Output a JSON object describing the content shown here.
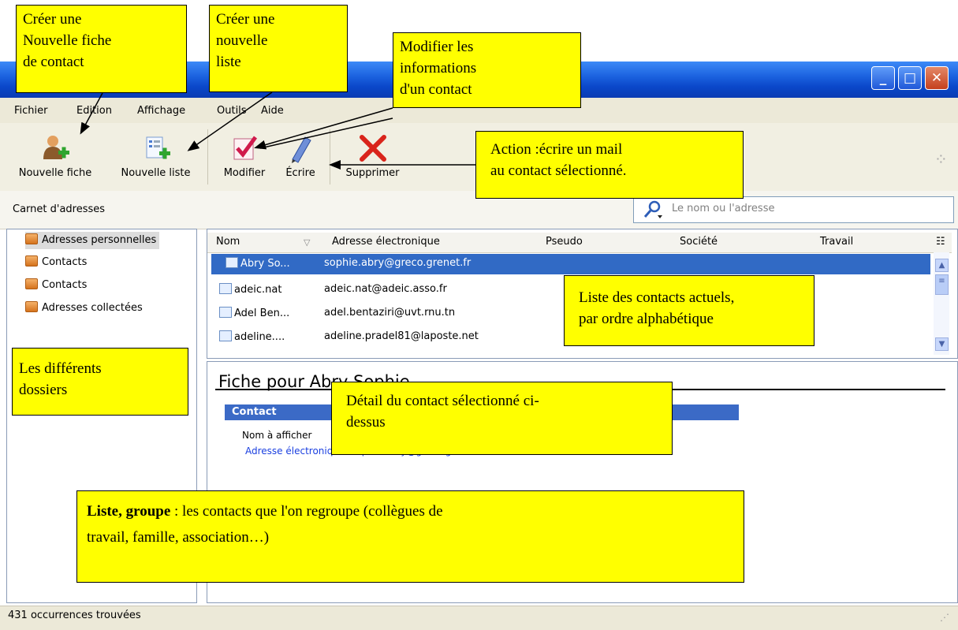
{
  "window": {
    "controls": [
      "_",
      "□",
      "✕"
    ]
  },
  "menu": [
    {
      "label": "Fichier",
      "key": "F"
    },
    {
      "label": "Edition",
      "key": "E"
    },
    {
      "label": "Affichage",
      "key": "c"
    },
    {
      "label": "Outils",
      "key": "O"
    },
    {
      "label": "Aide",
      "key": "A"
    }
  ],
  "toolbar": {
    "new_card": "Nouvelle fiche",
    "new_list": "Nouvelle liste",
    "edit": "Modifier",
    "write": "Écrire",
    "delete": "Supprimer"
  },
  "addressbook_label": "Carnet d'adresses",
  "search": {
    "placeholder": "Le nom ou l'adresse"
  },
  "folders": [
    {
      "label": "Adresses personnelles",
      "selected": true
    },
    {
      "label": "Contacts"
    },
    {
      "label": "Contacts"
    },
    {
      "label": "Adresses collectées"
    }
  ],
  "columns": [
    "Nom",
    "Adresse électronique",
    "Pseudo",
    "Société",
    "Travail"
  ],
  "contacts": [
    {
      "name": "Abry So...",
      "email": "sophie.abry@greco.grenet.fr",
      "selected": true
    },
    {
      "name": "adeic.nat",
      "email": "adeic.nat@adeic.asso.fr"
    },
    {
      "name": "Adel Ben...",
      "email": "adel.bentaziri@uvt.rnu.tn"
    },
    {
      "name": "adeline....",
      "email": "adeline.pradel81@laposte.net"
    }
  ],
  "detail": {
    "title": "Fiche pour Abry Sophie",
    "section": "Contact",
    "display_name_label": "Nom à afficher",
    "email_label": "Adresse électronique: sophie.abry@greco.grenet.fr"
  },
  "status": "431 occurrences trouvées",
  "callouts": {
    "new_card": [
      "Créer une",
      "Nouvelle fiche",
      "de contact"
    ],
    "new_list": [
      "Créer une",
      "nouvelle",
      "liste"
    ],
    "modify": [
      "Modifier les",
      "informations",
      "d'un contact"
    ],
    "write_action": [
      "Action :écrire un mail",
      "au contact sélectionné."
    ],
    "contacts_list": [
      "Liste des contacts actuels,",
      "par ordre alphabétique"
    ],
    "folders": [
      "Les différents",
      "dossiers"
    ],
    "detail": [
      "Détail du contact sélectionné ci-",
      "dessus"
    ],
    "list_group_bold": "Liste, groupe",
    "list_group_rest": " : les contacts que l'on regroupe (collègues de",
    "list_group_line2": "travail, famille, association…)"
  },
  "colors": {
    "title_bar": "#0a47c9",
    "selection": "#316ac5",
    "callout": "#ffff00",
    "section_band": "#3b6ac6"
  }
}
